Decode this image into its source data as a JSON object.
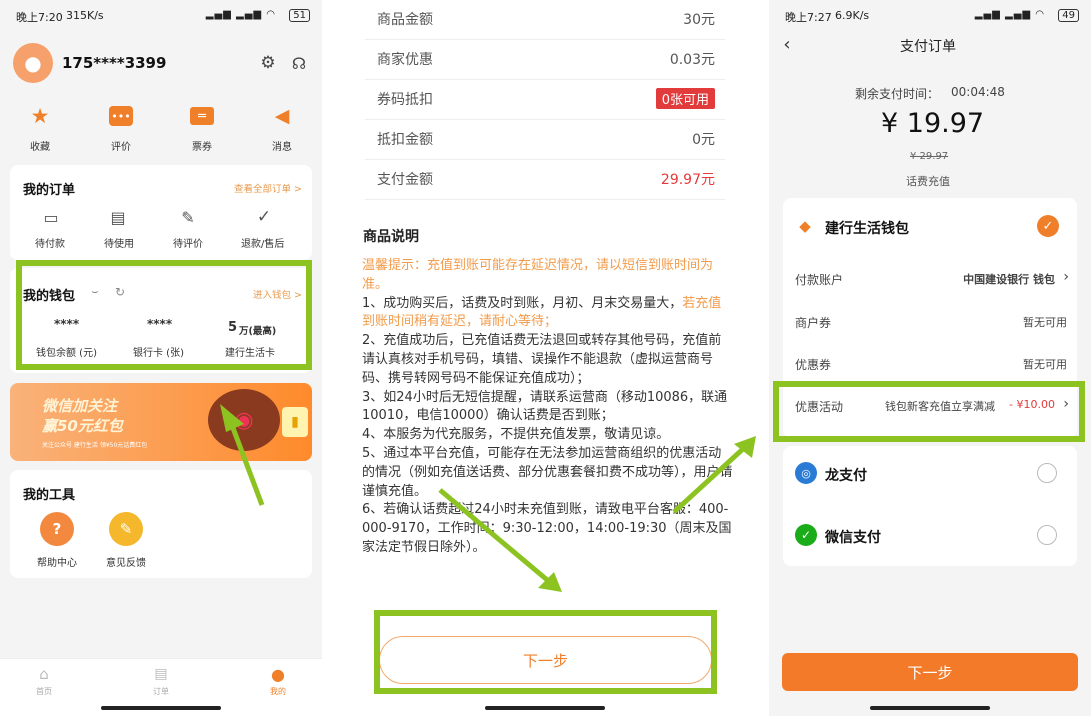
{
  "status_left": {
    "time": "晚上7:20",
    "speed": "315K/s",
    "battery": "51"
  },
  "status_right": {
    "time": "晚上7:27",
    "speed": "6.9K/s",
    "battery": "49"
  },
  "profile": {
    "phone": "175****3399"
  },
  "quick": {
    "favorites": "收藏",
    "reviews": "评价",
    "tickets": "票券",
    "messages": "消息"
  },
  "orders": {
    "title": "我的订单",
    "view_all": "查看全部订单 >",
    "items": [
      "待付款",
      "待使用",
      "待评价",
      "退款/售后"
    ]
  },
  "wallet": {
    "title": "我的钱包",
    "enter": "进入钱包 >",
    "balance_value": "****",
    "balance_label": "钱包余额 (元)",
    "cards_value": "****",
    "cards_label": "银行卡 (张)",
    "ccb_value": "5",
    "ccb_unit": "万(最高)",
    "ccb_label": "建行生活卡"
  },
  "banner": {
    "line1": "微信加关注",
    "line2": "赢50元红包",
    "small": "关注公众号 建行生活 领¥50元话费红包"
  },
  "tools": {
    "title": "我的工具",
    "help": "帮助中心",
    "feedback": "意见反馈"
  },
  "bottom_nav": {
    "home": "首页",
    "orders": "订单",
    "mine": "我的"
  },
  "order_detail": {
    "rows": [
      {
        "k": "商品金额",
        "v": "30元"
      },
      {
        "k": "商家优惠",
        "v": "0.03元"
      },
      {
        "k": "券码抵扣",
        "v": "0张可用"
      },
      {
        "k": "抵扣金额",
        "v": "0元"
      },
      {
        "k": "支付金额",
        "v": "29.97元"
      }
    ],
    "section_title": "商品说明",
    "tip": "温馨提示：充值到账可能存在延迟情况，请以短信到账时间为准。",
    "p1a": "1、成功购买后，话费及时到账，月初、月末交易量大，",
    "p1b": "若充值到账时间稍有延迟，请耐心等待；",
    "p2": "2、充值成功后，已充值话费无法退回或转存其他号码，充值前请认真核对手机号码，填错、误操作不能退款（虚拟运营商号码、携号转网号码不能保证充值成功）；",
    "p3": "3、如24小时后无短信提醒，请联系运营商（移动10086，联通10010，电信10000）确认话费是否到账；",
    "p4": "4、本服务为代充服务，不提供充值发票，敬请见谅。",
    "p5": "5、通过本平台充值，可能存在无法参加运营商组织的优惠活动的情况（例如充值送话费、部分优惠套餐扣费不成功等），用户请谨慎充值。",
    "p6": "6、若确认话费超过24小时未充值到账，请致电平台客服：400-000-9170，工作时间：9:30-12:00，14:00-19:30（周末及国家法定节假日除外）。",
    "next": "下一步"
  },
  "payment": {
    "title": "支付订单",
    "countdown_label": "剩余支付时间：",
    "countdown": "00:04:48",
    "amount": "¥ 19.97",
    "original": "¥ 29.97",
    "product": "话费充值",
    "wallet_name": "建行生活钱包",
    "account_label": "付款账户",
    "account_value": "中国建设银行 钱包",
    "merchant_coupon_label": "商户券",
    "merchant_coupon_value": "暂无可用",
    "coupon_label": "优惠券",
    "coupon_value": "暂无可用",
    "promo_label": "优惠活动",
    "promo_desc": "钱包新客充值立享满减",
    "promo_amount": "- ¥10.00",
    "long_pay": "龙支付",
    "wechat_pay": "微信支付",
    "next": "下一步"
  },
  "colors": {
    "accent": "#f07f2a",
    "highlight": "#8dc321",
    "red": "#e23b3b"
  }
}
